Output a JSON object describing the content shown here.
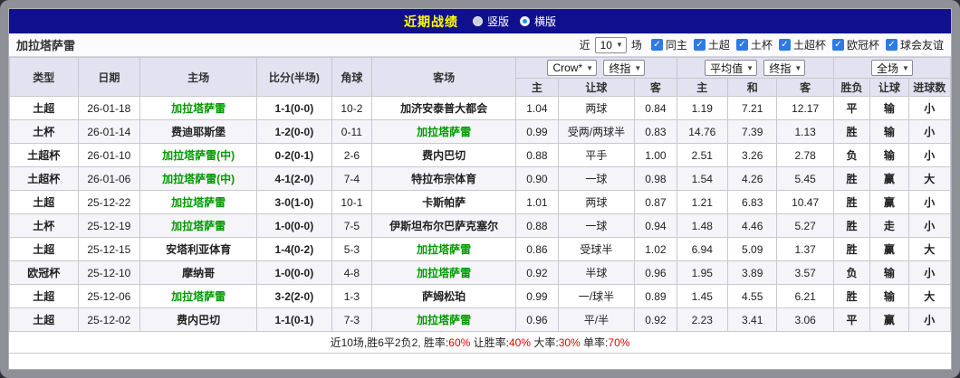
{
  "colors": {
    "league_tuchao": "#A08228",
    "league_tubei": "#FFC966",
    "league_tuchaobei": "#61A153",
    "league_ouguanbei": "#FF5511",
    "win_red": "#E60000",
    "lose_blue": "#0000E0",
    "draw_green": "#007A00",
    "team_highlight_green": "#009900",
    "topbar_navy": "#10108E",
    "title_yellow": "#FFFF00"
  },
  "topbar": {
    "title": "近期战绩",
    "options": [
      {
        "label": "竖版",
        "selected": false
      },
      {
        "label": "横版",
        "selected": true
      }
    ]
  },
  "filterbar": {
    "team_name": "加拉塔萨雷",
    "recent_prefix": "近",
    "match_count": "10",
    "recent_suffix": "场",
    "checkboxes": [
      {
        "label": "同主",
        "checked": true
      },
      {
        "label": "土超",
        "checked": true
      },
      {
        "label": "土杯",
        "checked": true
      },
      {
        "label": "土超杯",
        "checked": true
      },
      {
        "label": "欧冠杯",
        "checked": true
      },
      {
        "label": "球会友谊",
        "checked": true
      }
    ]
  },
  "table": {
    "main_headers": [
      "类型",
      "日期",
      "主场",
      "比分(半场)",
      "角球",
      "客场"
    ],
    "group1": {
      "select_a": "Crow*",
      "select_b": "终指",
      "cols": [
        "主",
        "让球",
        "客"
      ]
    },
    "group2": {
      "select_a": "平均值",
      "select_b": "终指",
      "cols": [
        "主",
        "和",
        "客"
      ]
    },
    "group3": {
      "select_a": "全场",
      "cols": [
        "胜负",
        "让球",
        "进球数"
      ]
    },
    "rows": [
      {
        "type": "土超",
        "type_class": "tuchao",
        "date": "26-01-18",
        "home": "加拉塔萨雷",
        "home_hl": true,
        "score": "1-1(0-0)",
        "corner": "10-2",
        "away": "加济安泰普大都会",
        "away_hl": false,
        "o1h": "1.04",
        "hcap": "两球",
        "o1a": "0.84",
        "avgh": "1.19",
        "avgd": "7.21",
        "avga": "12.17",
        "res": "平",
        "res_c": "draw",
        "hres": "输",
        "hres_c": "lose",
        "gres": "小",
        "gres_c": "lose"
      },
      {
        "type": "土杯",
        "type_class": "tubei",
        "date": "26-01-14",
        "home": "费迪耶斯堡",
        "home_hl": false,
        "score": "1-2(0-0)",
        "corner": "0-11",
        "away": "加拉塔萨雷",
        "away_hl": true,
        "o1h": "0.99",
        "hcap": "受两/两球半",
        "o1a": "0.83",
        "avgh": "14.76",
        "avgd": "7.39",
        "avga": "1.13",
        "res": "胜",
        "res_c": "win",
        "hres": "输",
        "hres_c": "lose",
        "gres": "小",
        "gres_c": "lose"
      },
      {
        "type": "土超杯",
        "type_class": "tuchaobei",
        "date": "26-01-10",
        "home": "加拉塔萨雷(中)",
        "home_hl": true,
        "score": "0-2(0-1)",
        "corner": "2-6",
        "away": "费内巴切",
        "away_hl": false,
        "o1h": "0.88",
        "hcap": "平手",
        "o1a": "1.00",
        "avgh": "2.51",
        "avgd": "3.26",
        "avga": "2.78",
        "res": "负",
        "res_c": "lose",
        "hres": "输",
        "hres_c": "lose",
        "gres": "小",
        "gres_c": "lose"
      },
      {
        "type": "土超杯",
        "type_class": "tuchaobei",
        "date": "26-01-06",
        "home": "加拉塔萨雷(中)",
        "home_hl": true,
        "score": "4-1(2-0)",
        "corner": "7-4",
        "away": "特拉布宗体育",
        "away_hl": false,
        "o1h": "0.90",
        "hcap": "一球",
        "o1a": "0.98",
        "avgh": "1.54",
        "avgd": "4.26",
        "avga": "5.45",
        "res": "胜",
        "res_c": "win",
        "hres": "赢",
        "hres_c": "win",
        "gres": "大",
        "gres_c": "win"
      },
      {
        "type": "土超",
        "type_class": "tuchao",
        "date": "25-12-22",
        "home": "加拉塔萨雷",
        "home_hl": true,
        "score": "3-0(1-0)",
        "corner": "10-1",
        "away": "卡斯帕萨",
        "away_hl": false,
        "o1h": "1.01",
        "hcap": "两球",
        "o1a": "0.87",
        "avgh": "1.21",
        "avgd": "6.83",
        "avga": "10.47",
        "res": "胜",
        "res_c": "win",
        "hres": "赢",
        "hres_c": "win",
        "gres": "小",
        "gres_c": "lose"
      },
      {
        "type": "土杯",
        "type_class": "tubei",
        "date": "25-12-19",
        "home": "加拉塔萨雷",
        "home_hl": true,
        "score": "1-0(0-0)",
        "corner": "7-5",
        "away": "伊斯坦布尔巴萨克塞尔",
        "away_hl": false,
        "o1h": "0.88",
        "hcap": "一球",
        "o1a": "0.94",
        "avgh": "1.48",
        "avgd": "4.46",
        "avga": "5.27",
        "res": "胜",
        "res_c": "win",
        "hres": "走",
        "hres_c": "draw",
        "gres": "小",
        "gres_c": "lose"
      },
      {
        "type": "土超",
        "type_class": "tuchao",
        "date": "25-12-15",
        "home": "安塔利亚体育",
        "home_hl": false,
        "score": "1-4(0-2)",
        "corner": "5-3",
        "away": "加拉塔萨雷",
        "away_hl": true,
        "o1h": "0.86",
        "hcap": "受球半",
        "o1a": "1.02",
        "avgh": "6.94",
        "avgd": "5.09",
        "avga": "1.37",
        "res": "胜",
        "res_c": "win",
        "hres": "赢",
        "hres_c": "win",
        "gres": "大",
        "gres_c": "win"
      },
      {
        "type": "欧冠杯",
        "type_class": "ouguan",
        "date": "25-12-10",
        "home": "摩纳哥",
        "home_hl": false,
        "score": "1-0(0-0)",
        "corner": "4-8",
        "away": "加拉塔萨雷",
        "away_hl": true,
        "o1h": "0.92",
        "hcap": "半球",
        "o1a": "0.96",
        "avgh": "1.95",
        "avgd": "3.89",
        "avga": "3.57",
        "res": "负",
        "res_c": "lose",
        "hres": "输",
        "hres_c": "lose",
        "gres": "小",
        "gres_c": "lose"
      },
      {
        "type": "土超",
        "type_class": "tuchao",
        "date": "25-12-06",
        "home": "加拉塔萨雷",
        "home_hl": true,
        "score": "3-2(2-0)",
        "corner": "1-3",
        "away": "萨姆松珀",
        "away_hl": false,
        "o1h": "0.99",
        "hcap": "一/球半",
        "o1a": "0.89",
        "avgh": "1.45",
        "avgd": "4.55",
        "avga": "6.21",
        "res": "胜",
        "res_c": "win",
        "hres": "输",
        "hres_c": "lose",
        "gres": "大",
        "gres_c": "win"
      },
      {
        "type": "土超",
        "type_class": "tuchao",
        "date": "25-12-02",
        "home": "费内巴切",
        "home_hl": false,
        "score": "1-1(0-1)",
        "corner": "7-3",
        "away": "加拉塔萨雷",
        "away_hl": true,
        "o1h": "0.96",
        "hcap": "平/半",
        "o1a": "0.92",
        "avgh": "2.23",
        "avgd": "3.41",
        "avga": "3.06",
        "res": "平",
        "res_c": "draw",
        "hres": "赢",
        "hres_c": "win",
        "gres": "小",
        "gres_c": "lose"
      }
    ]
  },
  "footer": {
    "segments": [
      {
        "text": "近10场,胜6平2负2, 胜率:",
        "red": false
      },
      {
        "text": "60%",
        "red": true
      },
      {
        "text": " 让胜率:",
        "red": false
      },
      {
        "text": "40%",
        "red": true
      },
      {
        "text": " 大率:",
        "red": false
      },
      {
        "text": "30%",
        "red": true
      },
      {
        "text": " 单率:",
        "red": false
      },
      {
        "text": "70%",
        "red": true
      }
    ]
  }
}
